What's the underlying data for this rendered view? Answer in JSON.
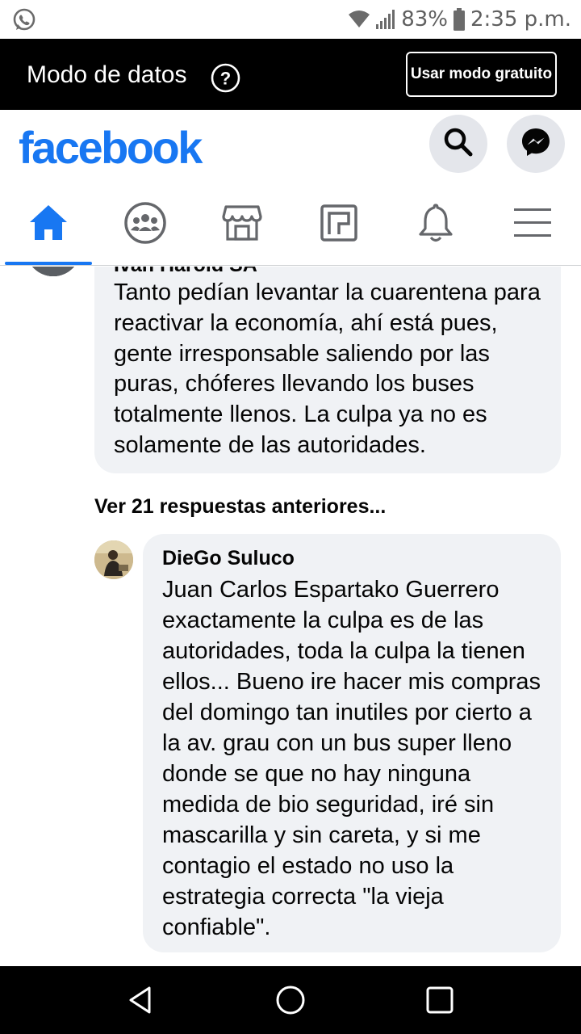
{
  "status_bar": {
    "battery": "83%",
    "time": "2:35 p.m.",
    "icons": [
      "whatsapp-icon",
      "wifi-icon",
      "signal-icon",
      "battery-icon"
    ]
  },
  "data_bar": {
    "title": "Modo de datos",
    "help_icon": "?",
    "free_mode_button": "Usar modo gratuito"
  },
  "header": {
    "logo": "facebook",
    "brand_color": "#1877f2",
    "actions": [
      "search-icon",
      "messenger-icon"
    ]
  },
  "nav": {
    "tabs": [
      {
        "icon": "home-icon",
        "active": true
      },
      {
        "icon": "groups-icon",
        "active": false
      },
      {
        "icon": "marketplace-icon",
        "active": false
      },
      {
        "icon": "watch-icon",
        "active": false
      },
      {
        "icon": "bell-icon",
        "active": false
      },
      {
        "icon": "menu-icon",
        "active": false
      }
    ]
  },
  "comments": {
    "first": {
      "author": "Ivan Harold SA",
      "text": "Tanto pedían levantar la cuarentena para reactivar la economía, ahí está pues, gente irresponsable saliendo por las puras, chóferes llevando los buses totalmente llenos. La culpa ya no es solamente de las autoridades."
    },
    "more_replies": "Ver 21 respuestas anteriores...",
    "reply": {
      "author": "DieGo Suluco",
      "text": "Juan Carlos Espartako Guerrero exactamente la culpa es de las autoridades, toda la culpa la tienen ellos... Bueno ire hacer mis compras del domingo tan inutiles por cierto a la av. grau con un bus super lleno donde se que no hay ninguna medida de bio seguridad, iré sin mascarilla y sin careta, y si me contagio el estado no uso la estrategia correcta \"la vieja confiable\"."
    }
  },
  "android_nav": [
    "back-icon",
    "home-circle-icon",
    "recents-icon"
  ]
}
